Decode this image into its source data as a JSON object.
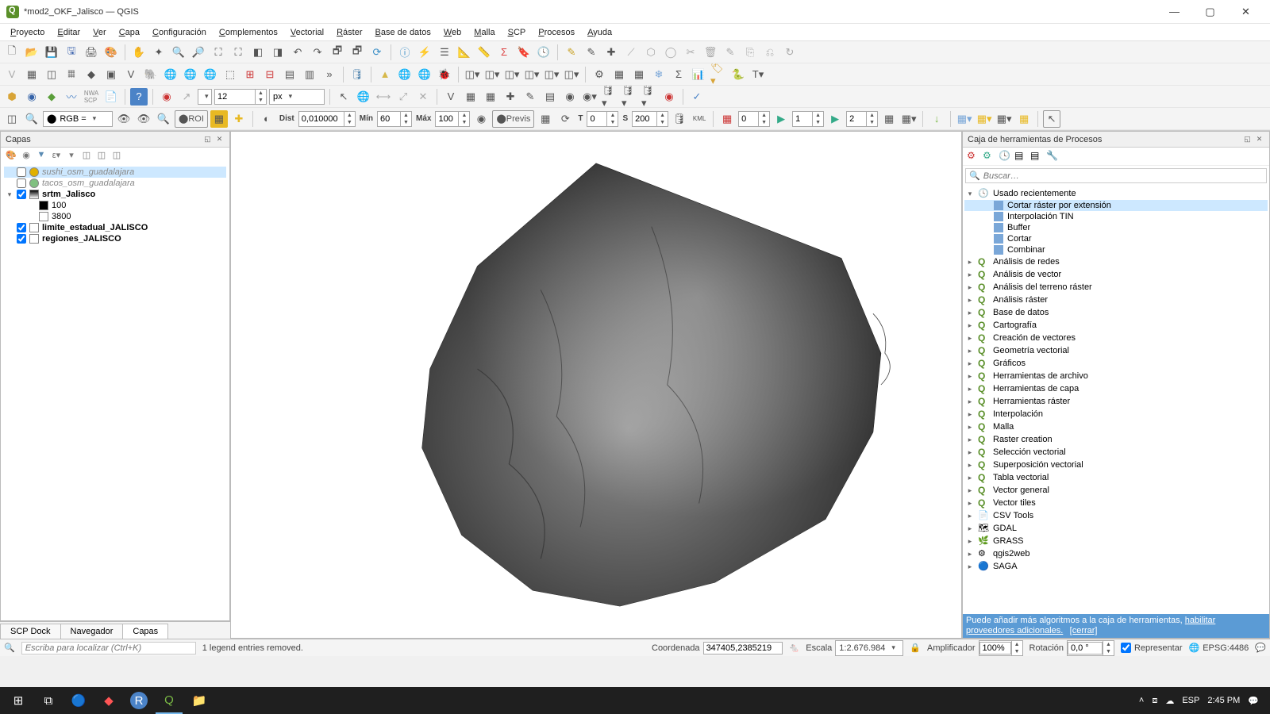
{
  "window": {
    "title": "*mod2_OKF_Jalisco — QGIS"
  },
  "menu": [
    "Proyecto",
    "Editar",
    "Ver",
    "Capa",
    "Configuración",
    "Complementos",
    "Vectorial",
    "Ráster",
    "Base de datos",
    "Web",
    "Malla",
    "SCP",
    "Procesos",
    "Ayuda"
  ],
  "toolbar3": {
    "size": "12",
    "unit": "px"
  },
  "toolbar4": {
    "rgb": "RGB =",
    "roi": "ROI",
    "dist_label": "Dist",
    "dist": "0,010000",
    "min_label": "Mín",
    "min": "60",
    "max_label": "Máx",
    "max": "100",
    "previs": "Previs",
    "t": "0",
    "s": "200"
  },
  "toolbar4b": {
    "a": "0",
    "b": "1",
    "c": "2"
  },
  "layers_panel": {
    "title": "Capas",
    "items": [
      {
        "type": "layer",
        "name": "sushi_osm_guadalajara",
        "checked": false,
        "color": "#e0b000",
        "italic": true,
        "sel": true
      },
      {
        "type": "layer",
        "name": "tacos_osm_guadalajara",
        "checked": false,
        "color": "#80c080",
        "italic": true
      },
      {
        "type": "group",
        "name": "srtm_Jalisco",
        "checked": true,
        "expanded": true,
        "raster": true,
        "children": [
          {
            "label": "100",
            "sw": "#000"
          },
          {
            "label": "3800",
            "sw": "#fff"
          }
        ]
      },
      {
        "type": "layer",
        "name": "limite_estadual_JALISCO",
        "checked": true,
        "box": true,
        "bold": true
      },
      {
        "type": "layer",
        "name": "regiones_JALISCO",
        "checked": true,
        "box": true,
        "bold": true
      }
    ]
  },
  "bottom_tabs": [
    "SCP Dock",
    "Navegador",
    "Capas"
  ],
  "processing_panel": {
    "title": "Caja de herramientas de Procesos",
    "search_placeholder": "Buscar…",
    "recent_label": "Usado recientemente",
    "recent": [
      "Cortar ráster por extensión",
      "Interpolación TIN",
      "Buffer",
      "Cortar",
      "Combinar"
    ],
    "groups": [
      "Análisis de redes",
      "Análisis de vector",
      "Análisis del terreno ráster",
      "Análisis ráster",
      "Base de datos",
      "Cartografía",
      "Creación de vectores",
      "Geometría vectorial",
      "Gráficos",
      "Herramientas de archivo",
      "Herramientas de capa",
      "Herramientas ráster",
      "Interpolación",
      "Malla",
      "Raster creation",
      "Selección vectorial",
      "Superposición vectorial",
      "Tabla vectorial",
      "Vector general",
      "Vector tiles"
    ],
    "providers": [
      {
        "name": "CSV Tools",
        "icon": "csv"
      },
      {
        "name": "GDAL",
        "icon": "gdal"
      },
      {
        "name": "GRASS",
        "icon": "grass"
      },
      {
        "name": "qgis2web",
        "icon": "q2w"
      },
      {
        "name": "SAGA",
        "icon": "saga"
      }
    ],
    "hint_prefix": "Puede añadir más algoritmos a la caja de herramientas, ",
    "hint_link1": "habilitar proveedores adicionales.",
    "hint_link2": "[cerrar]"
  },
  "statusbar": {
    "locator_placeholder": "Escriba para localizar (Ctrl+K)",
    "msg": "1 legend entries removed.",
    "coord_label": "Coordenada",
    "coord": "347405,2385219",
    "scale_label": "Escala",
    "scale": "1:2.676.984",
    "mag_label": "Amplificador",
    "mag": "100%",
    "rot_label": "Rotación",
    "rot": "0,0 °",
    "render_label": "Representar",
    "crs": "EPSG:4486"
  },
  "taskbar": {
    "lang": "ESP",
    "time": "2:45 PM"
  }
}
